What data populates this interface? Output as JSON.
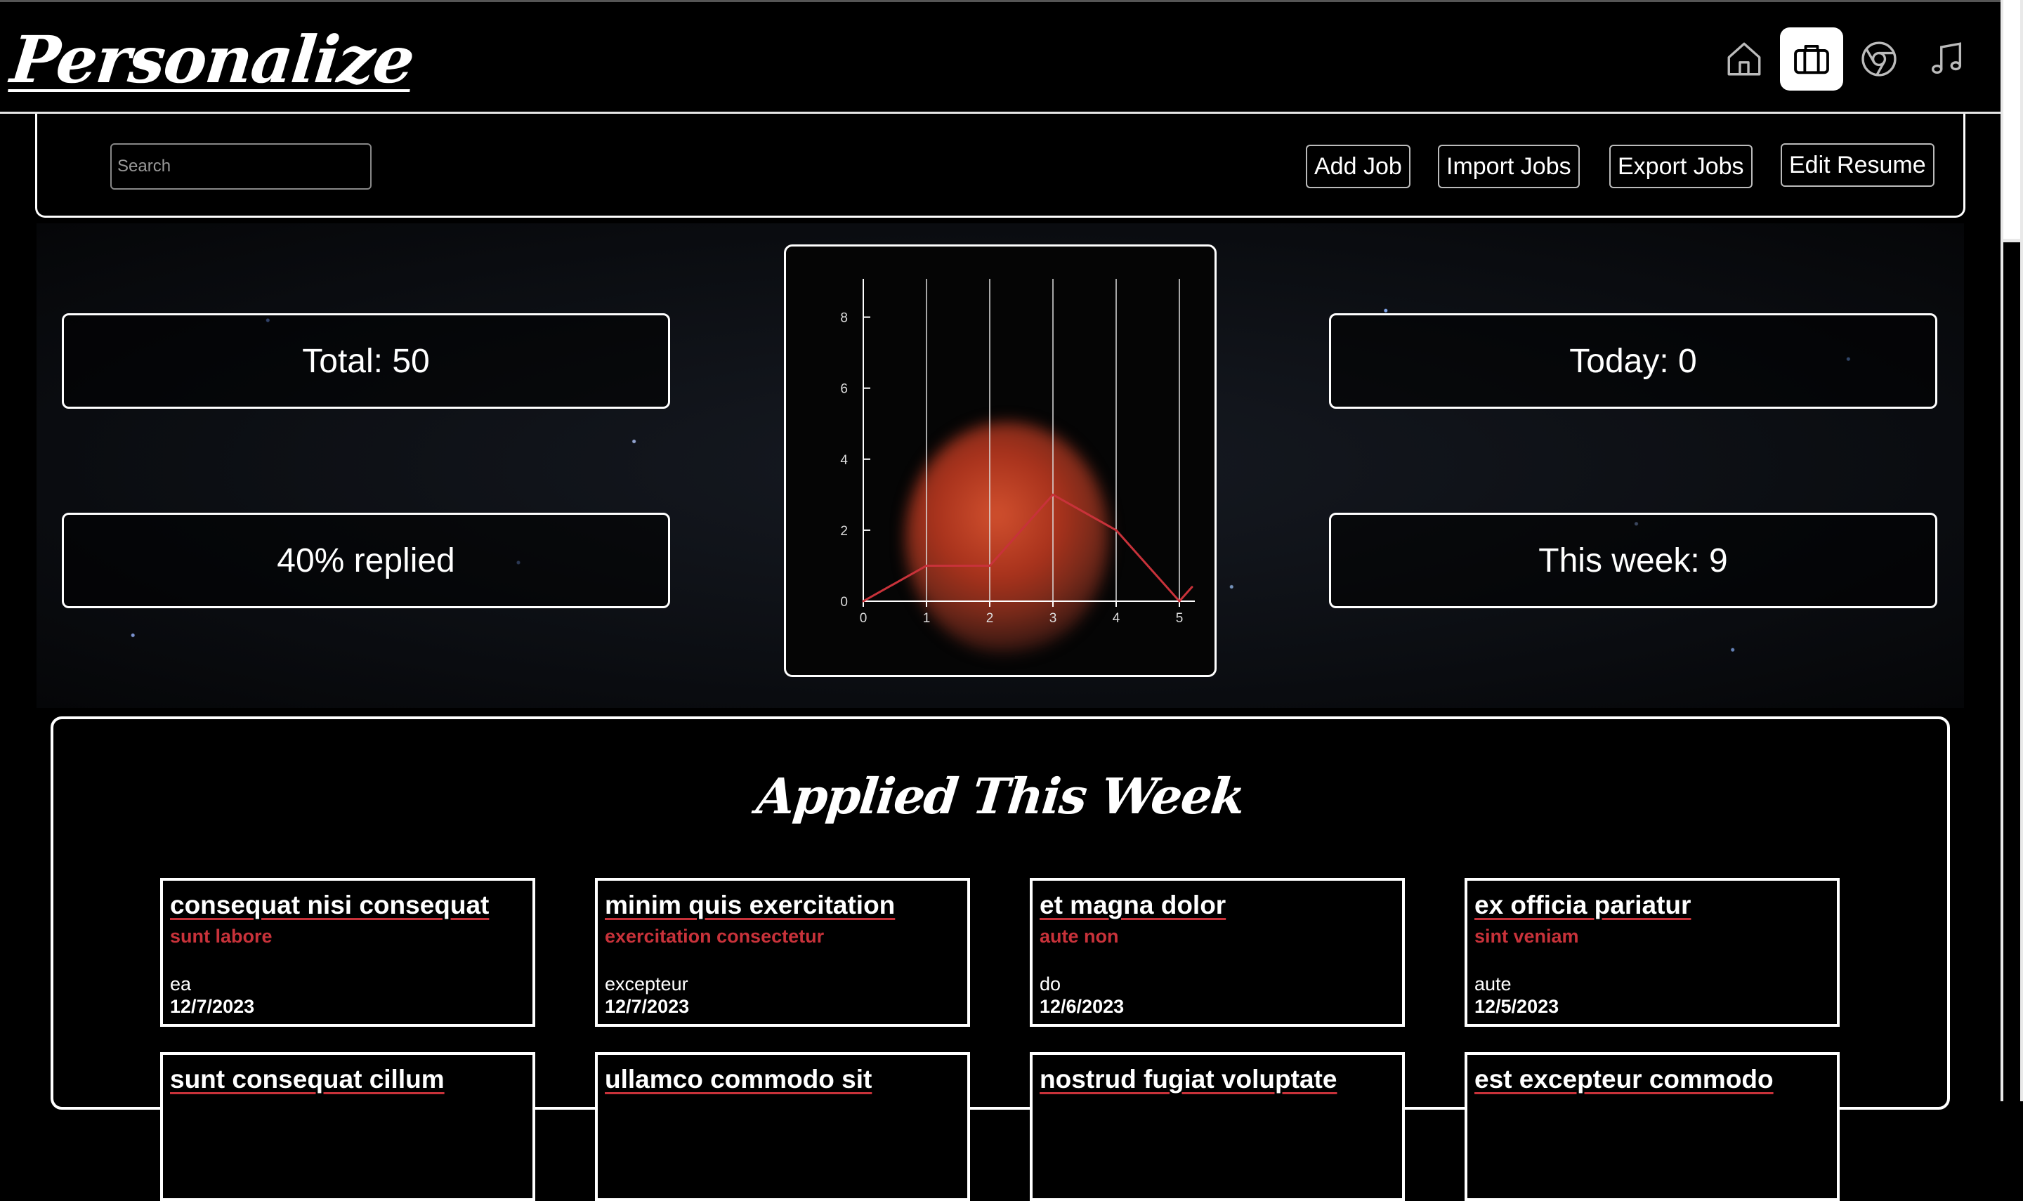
{
  "app": {
    "logo": "Personalize"
  },
  "nav": [
    {
      "icon": "home-icon",
      "active": false
    },
    {
      "icon": "briefcase-icon",
      "active": true
    },
    {
      "icon": "chrome-icon",
      "active": false
    },
    {
      "icon": "music-note-icon",
      "active": false
    }
  ],
  "toolbar": {
    "search_placeholder": "Search",
    "add_job": "Add Job",
    "import_jobs": "Import Jobs",
    "export_jobs": "Export Jobs",
    "edit_resume": "Edit Resume"
  },
  "stats": {
    "total": "Total: 50",
    "replied": "40% replied",
    "today": "Today: 0",
    "week": "This week: 9"
  },
  "chart_data": {
    "type": "line",
    "x": [
      0,
      1,
      2,
      3,
      4,
      5,
      5.2
    ],
    "series": [
      {
        "values": [
          0,
          1,
          1,
          3,
          2,
          0,
          0.4
        ],
        "color": "#c8323a"
      }
    ],
    "xticks": [
      0,
      1,
      2,
      3,
      4,
      5
    ],
    "yticks": [
      0,
      2,
      4,
      6,
      8
    ],
    "xlim": [
      0,
      5.2
    ],
    "ylim": [
      0,
      9
    ],
    "grid": "vertical",
    "title": "",
    "xlabel": "",
    "ylabel": ""
  },
  "applied_week": {
    "title": "Applied This Week",
    "cards": [
      {
        "title": "consequat nisi consequat",
        "company": "sunt labore",
        "location": "ea",
        "date": "12/7/2023"
      },
      {
        "title": "minim quis exercitation",
        "company": "exercitation consectetur",
        "location": "excepteur",
        "date": "12/7/2023"
      },
      {
        "title": "et magna dolor",
        "company": "aute non",
        "location": "do",
        "date": "12/6/2023"
      },
      {
        "title": "ex officia pariatur",
        "company": "sint veniam",
        "location": "aute",
        "date": "12/5/2023"
      },
      {
        "title": "sunt consequat cillum"
      },
      {
        "title": "ullamco commodo sit"
      },
      {
        "title": "nostrud fugiat voluptate"
      },
      {
        "title": "est excepteur commodo"
      }
    ]
  }
}
